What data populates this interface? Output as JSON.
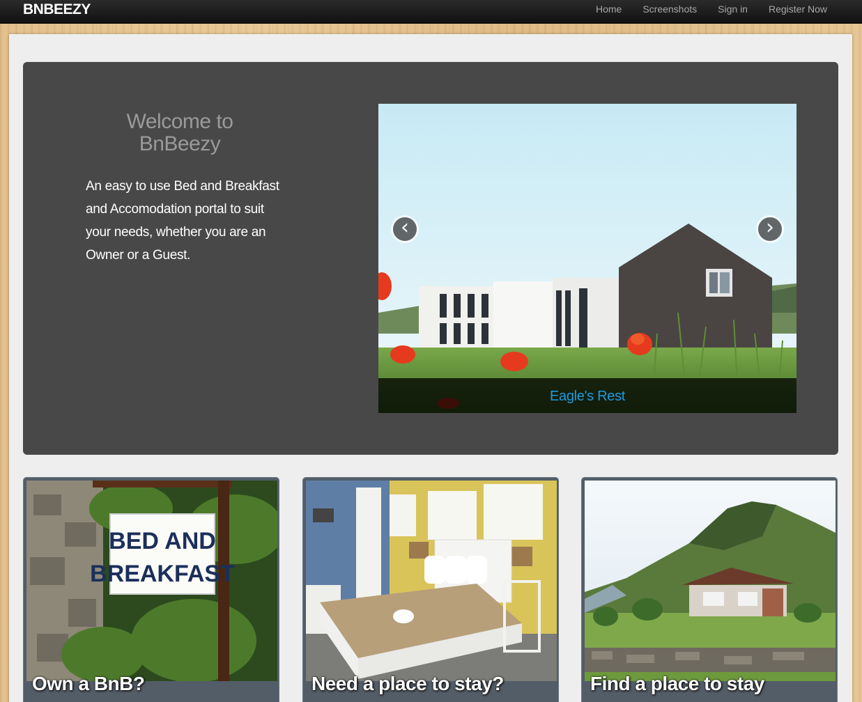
{
  "navbar": {
    "brand": "BNBEEZY",
    "links": [
      "Home",
      "Screenshots",
      "Sign in",
      "Register Now"
    ]
  },
  "hero": {
    "title": "Welcome to BnBeezy",
    "text": "An easy to use Bed and Breakfast and Accomodation portal to suit your needs, whether you are an Owner or a Guest."
  },
  "carousel": {
    "caption": "Eagle's Rest",
    "prev_icon": "chevron-left-icon",
    "next_icon": "chevron-right-icon",
    "prev_glyph": "‹",
    "next_glyph": "›"
  },
  "cards": [
    {
      "title": "Own a BnB?",
      "sign_line1": "BED AND",
      "sign_line2": "BREAKFAST"
    },
    {
      "title": "Need a place to stay?"
    },
    {
      "title": "Find a place to stay"
    }
  ],
  "colors": {
    "navbar": "#1a1a1a",
    "hero_bg": "#484848",
    "caption_link": "#1f9ae0",
    "card_bg": "#535d67"
  }
}
